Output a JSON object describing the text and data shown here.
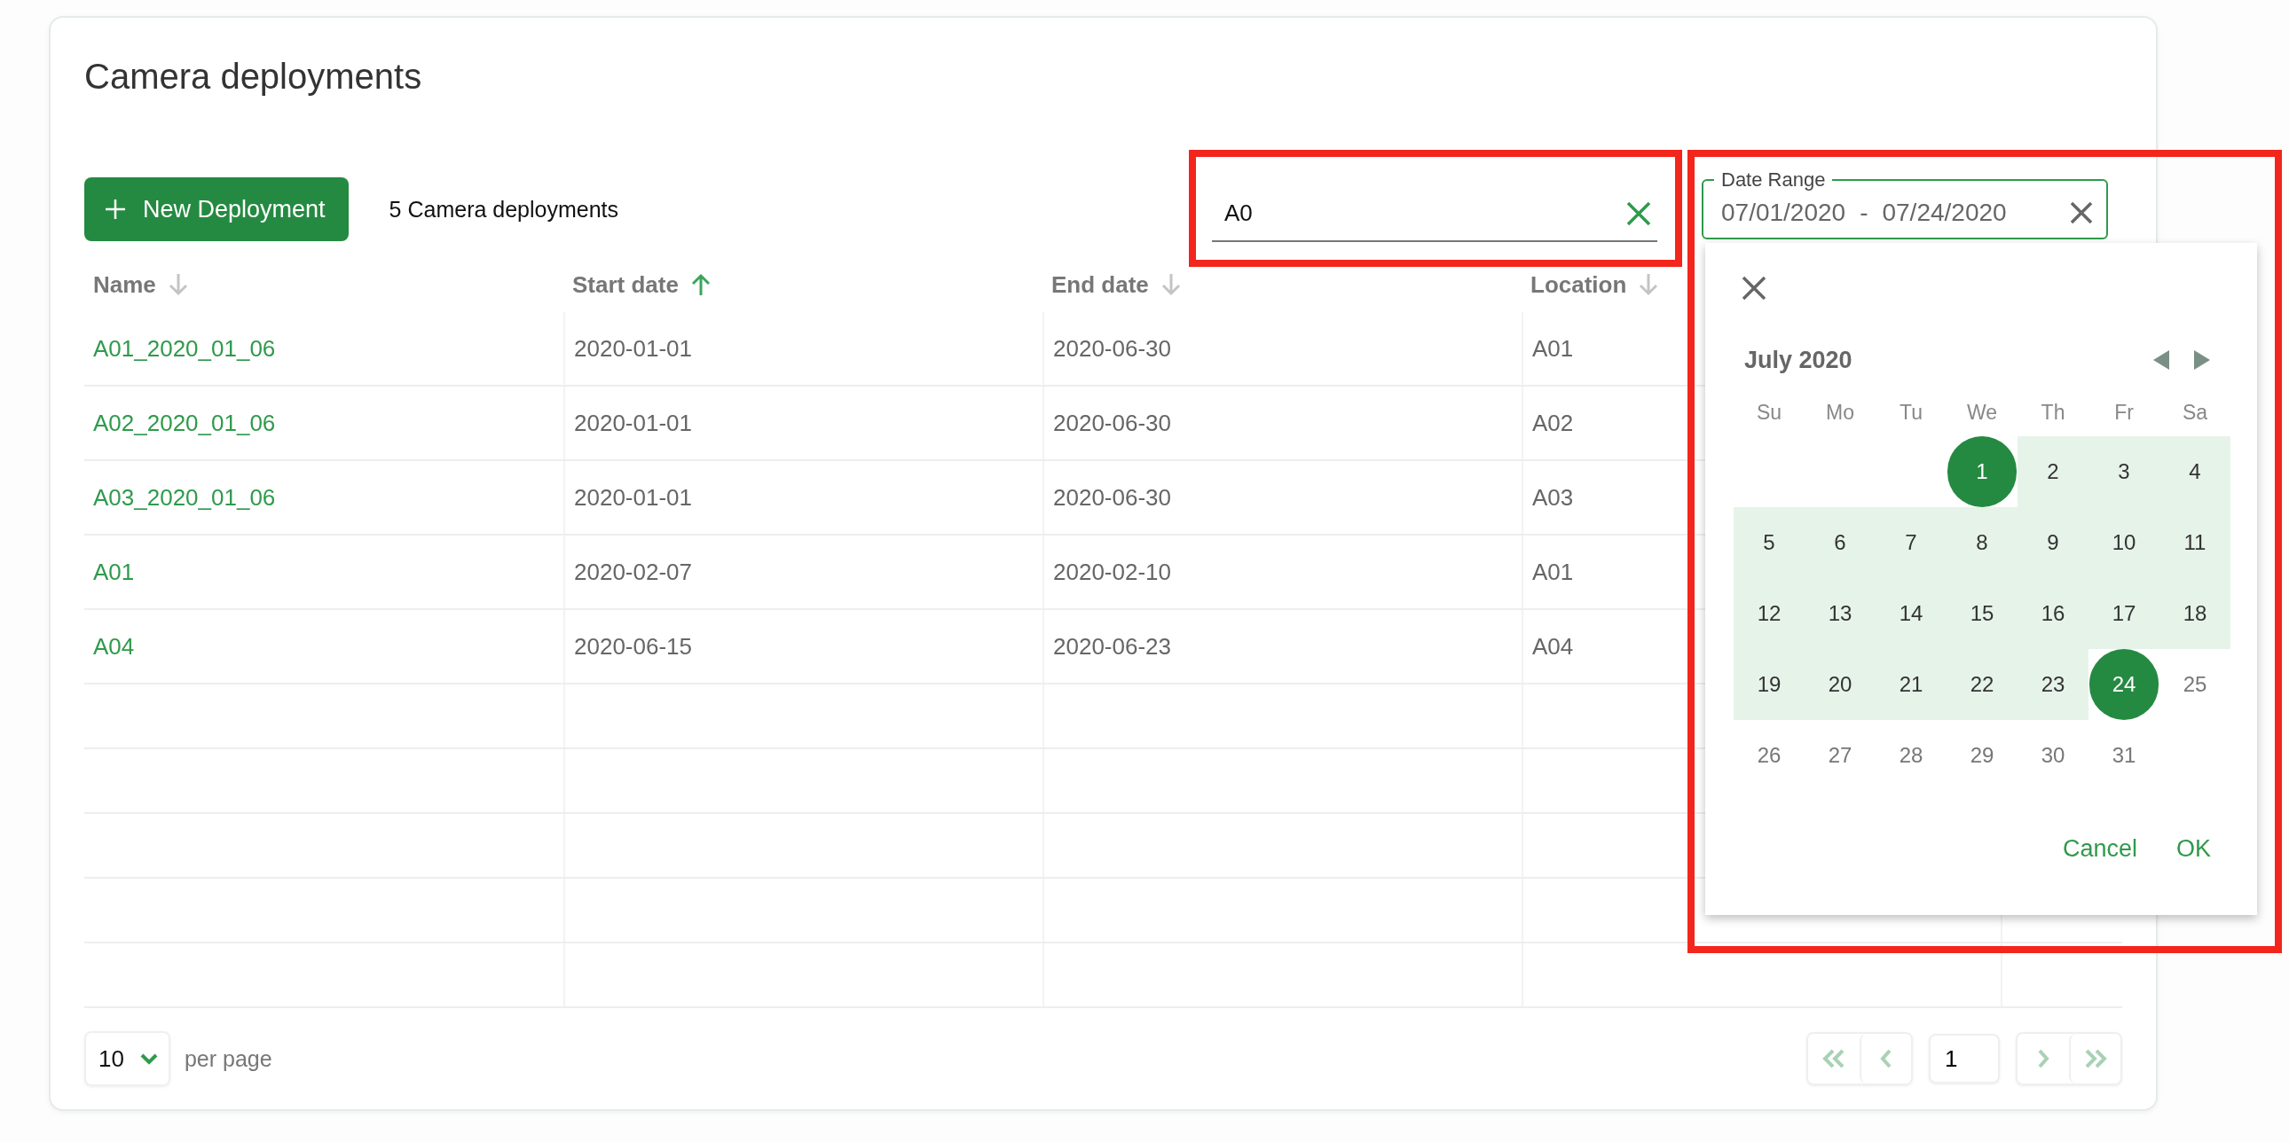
{
  "title": "Camera deployments",
  "new_button": {
    "label": "New Deployment"
  },
  "count": "5 Camera deployments",
  "search": {
    "value": "A0"
  },
  "date_range": {
    "label": "Date Range",
    "start": "07/01/2020",
    "separator": "-",
    "end": "07/24/2020"
  },
  "table": {
    "columns": [
      {
        "label": "Name",
        "sorted": false
      },
      {
        "label": "Start date",
        "sorted": true
      },
      {
        "label": "End date",
        "sorted": false
      },
      {
        "label": "Location",
        "sorted": false
      }
    ],
    "rows": [
      [
        "A01_2020_01_06",
        "2020-01-01",
        "2020-06-30",
        "A01"
      ],
      [
        "A02_2020_01_06",
        "2020-01-01",
        "2020-06-30",
        "A02"
      ],
      [
        "A03_2020_01_06",
        "2020-01-01",
        "2020-06-30",
        "A03"
      ],
      [
        "A01",
        "2020-02-07",
        "2020-02-10",
        "A01"
      ],
      [
        "A04",
        "2020-06-15",
        "2020-06-23",
        "A04"
      ]
    ]
  },
  "date_picker": {
    "month": "July 2020",
    "weekdays": [
      "Su",
      "Mo",
      "Tu",
      "We",
      "Th",
      "Fr",
      "Sa"
    ],
    "weeks": [
      {
        "days": [
          {
            "kind": "blank"
          },
          {
            "kind": "blank"
          },
          {
            "kind": "blank"
          },
          {
            "kind": "day",
            "label": "1",
            "selected": true
          },
          {
            "label": "2",
            "selected": false,
            "in_range": true
          },
          {
            "label": "3",
            "selected": false,
            "in_range": true
          },
          {
            "label": "4",
            "selected": false,
            "in_range": true
          }
        ]
      },
      {
        "days": [
          {
            "label": "5",
            "selected": false,
            "in_range": true
          },
          {
            "label": "6",
            "selected": false,
            "in_range": true
          },
          {
            "label": "7",
            "selected": false,
            "in_range": true
          },
          {
            "label": "8",
            "selected": false,
            "in_range": true
          },
          {
            "label": "9",
            "selected": false,
            "in_range": true
          },
          {
            "label": "10",
            "selected": false,
            "in_range": true
          },
          {
            "label": "11",
            "selected": false,
            "in_range": true
          }
        ]
      },
      {
        "days": [
          {
            "label": "12",
            "selected": false,
            "in_range": true
          },
          {
            "label": "13",
            "selected": false,
            "in_range": true
          },
          {
            "label": "14",
            "selected": false,
            "in_range": true
          },
          {
            "label": "15",
            "selected": false,
            "in_range": true
          },
          {
            "label": "16",
            "selected": false,
            "in_range": true
          },
          {
            "label": "17",
            "selected": false,
            "in_range": true
          },
          {
            "label": "18",
            "selected": false,
            "in_range": true
          }
        ]
      },
      {
        "days": [
          {
            "label": "19",
            "selected": false,
            "in_range": true
          },
          {
            "label": "20",
            "selected": false,
            "in_range": true
          },
          {
            "label": "21",
            "selected": false,
            "in_range": true
          },
          {
            "label": "22",
            "selected": false,
            "in_range": true
          },
          {
            "label": "23",
            "selected": false,
            "in_range": true
          },
          {
            "label": "24",
            "selected": true
          },
          {
            "label": "25",
            "selected": false,
            "in_range": false
          }
        ]
      },
      {
        "days": [
          {
            "label": "26",
            "selected": false,
            "in_range": false
          },
          {
            "label": "27",
            "selected": false,
            "in_range": false
          },
          {
            "label": "28",
            "selected": false,
            "in_range": false
          },
          {
            "label": "29",
            "selected": false,
            "in_range": false
          },
          {
            "label": "30",
            "selected": false,
            "in_range": false
          },
          {
            "label": "31",
            "selected": false,
            "in_range": false
          },
          {
            "kind": "blank"
          }
        ]
      }
    ],
    "buttons": [
      "Cancel",
      "OK"
    ]
  },
  "per_page": {
    "value": "10",
    "label": "per page"
  },
  "pagination": {
    "page": "1",
    "first_disabled": true,
    "prev_disabled": true,
    "next_disabled": true,
    "last_disabled": true
  }
}
